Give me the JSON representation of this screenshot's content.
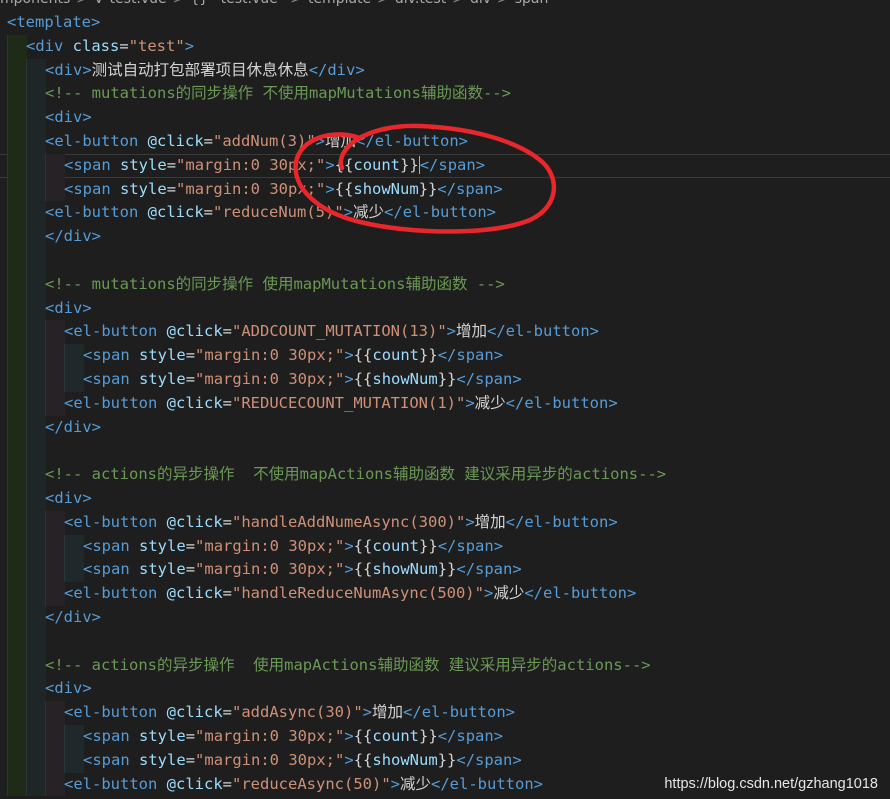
{
  "breadcrumb": [
    "mponents",
    ">",
    "V",
    "test.vue",
    ">",
    "{}",
    "\"test.vue\"",
    ">",
    "template",
    ">",
    "div.test",
    ">",
    "div",
    ">",
    "span"
  ],
  "colors": {
    "tag": "#569cd6",
    "attribute": "#9cdcfe",
    "string": "#ce9178",
    "comment": "#6a9955",
    "text": "#d4d4d4",
    "annotation_circle": "#e8262b"
  },
  "lines": [
    {
      "indent": 0,
      "cursor": false,
      "tokens": [
        [
          "tag",
          "<template"
        ],
        [
          "tag",
          ">"
        ]
      ]
    },
    {
      "indent": 1,
      "cursor": false,
      "tokens": [
        [
          "tag",
          "<div"
        ],
        [
          "text",
          " "
        ],
        [
          "attr",
          "class"
        ],
        [
          "text",
          "="
        ],
        [
          "str",
          "\"test\""
        ],
        [
          "tag",
          ">"
        ]
      ]
    },
    {
      "indent": 2,
      "cursor": false,
      "tokens": [
        [
          "tag",
          "<div>"
        ],
        [
          "text",
          "测试自动打包部署项目休息休息"
        ],
        [
          "tag",
          "</div>"
        ]
      ]
    },
    {
      "indent": 2,
      "cursor": false,
      "tokens": [
        [
          "cmt",
          "<!-- mutations的同步操作 不使用mapMutations辅助函数-->"
        ]
      ]
    },
    {
      "indent": 2,
      "cursor": false,
      "tokens": [
        [
          "tag",
          "<div>"
        ]
      ]
    },
    {
      "indent": 2,
      "cursor": false,
      "tokens": [
        [
          "tag",
          "<el-button"
        ],
        [
          "text",
          " "
        ],
        [
          "attr",
          "@click"
        ],
        [
          "text",
          "="
        ],
        [
          "str",
          "\"addNum(3)\""
        ],
        [
          "tag",
          ">"
        ],
        [
          "text",
          "增加"
        ],
        [
          "tag",
          "</el-button>"
        ]
      ]
    },
    {
      "indent": 3,
      "cursor": true,
      "tokens": [
        [
          "tag",
          "<span"
        ],
        [
          "text",
          " "
        ],
        [
          "attr",
          "style"
        ],
        [
          "text",
          "="
        ],
        [
          "str",
          "\"margin:0 30px;\""
        ],
        [
          "tag",
          ">"
        ],
        [
          "text",
          "{{"
        ],
        [
          "var",
          "count"
        ],
        [
          "text",
          "}}"
        ],
        [
          "tag",
          "</span>"
        ]
      ]
    },
    {
      "indent": 3,
      "cursor": false,
      "tokens": [
        [
          "tag",
          "<span"
        ],
        [
          "text",
          " "
        ],
        [
          "attr",
          "style"
        ],
        [
          "text",
          "="
        ],
        [
          "str",
          "\"margin:0 30px;\""
        ],
        [
          "tag",
          ">"
        ],
        [
          "text",
          "{{"
        ],
        [
          "var",
          "showNum"
        ],
        [
          "text",
          "}}"
        ],
        [
          "tag",
          "</span>"
        ]
      ]
    },
    {
      "indent": 2,
      "cursor": false,
      "tokens": [
        [
          "tag",
          "<el-button"
        ],
        [
          "text",
          " "
        ],
        [
          "attr",
          "@click"
        ],
        [
          "text",
          "="
        ],
        [
          "str",
          "\"reduceNum(5)\""
        ],
        [
          "tag",
          ">"
        ],
        [
          "text",
          "减少"
        ],
        [
          "tag",
          "</el-button>"
        ]
      ]
    },
    {
      "indent": 2,
      "cursor": false,
      "tokens": [
        [
          "tag",
          "</div>"
        ]
      ]
    },
    {
      "indent": 2,
      "cursor": false,
      "tokens": []
    },
    {
      "indent": 2,
      "cursor": false,
      "tokens": [
        [
          "cmt",
          "<!-- mutations的同步操作 使用mapMutations辅助函数 -->"
        ]
      ]
    },
    {
      "indent": 2,
      "cursor": false,
      "tokens": [
        [
          "tag",
          "<div>"
        ]
      ]
    },
    {
      "indent": 3,
      "cursor": false,
      "tokens": [
        [
          "tag",
          "<el-button"
        ],
        [
          "text",
          " "
        ],
        [
          "attr",
          "@click"
        ],
        [
          "text",
          "="
        ],
        [
          "str",
          "\"ADDCOUNT_MUTATION(13)\""
        ],
        [
          "tag",
          ">"
        ],
        [
          "text",
          "增加"
        ],
        [
          "tag",
          "</el-button>"
        ]
      ]
    },
    {
      "indent": 4,
      "cursor": false,
      "tokens": [
        [
          "tag",
          "<span"
        ],
        [
          "text",
          " "
        ],
        [
          "attr",
          "style"
        ],
        [
          "text",
          "="
        ],
        [
          "str",
          "\"margin:0 30px;\""
        ],
        [
          "tag",
          ">"
        ],
        [
          "text",
          "{{"
        ],
        [
          "var",
          "count"
        ],
        [
          "text",
          "}}"
        ],
        [
          "tag",
          "</span>"
        ]
      ]
    },
    {
      "indent": 4,
      "cursor": false,
      "tokens": [
        [
          "tag",
          "<span"
        ],
        [
          "text",
          " "
        ],
        [
          "attr",
          "style"
        ],
        [
          "text",
          "="
        ],
        [
          "str",
          "\"margin:0 30px;\""
        ],
        [
          "tag",
          ">"
        ],
        [
          "text",
          "{{"
        ],
        [
          "var",
          "showNum"
        ],
        [
          "text",
          "}}"
        ],
        [
          "tag",
          "</span>"
        ]
      ]
    },
    {
      "indent": 3,
      "cursor": false,
      "tokens": [
        [
          "tag",
          "<el-button"
        ],
        [
          "text",
          " "
        ],
        [
          "attr",
          "@click"
        ],
        [
          "text",
          "="
        ],
        [
          "str",
          "\"REDUCECOUNT_MUTATION(1)\""
        ],
        [
          "tag",
          ">"
        ],
        [
          "text",
          "减少"
        ],
        [
          "tag",
          "</el-button>"
        ]
      ]
    },
    {
      "indent": 2,
      "cursor": false,
      "tokens": [
        [
          "tag",
          "</div>"
        ]
      ]
    },
    {
      "indent": 2,
      "cursor": false,
      "tokens": []
    },
    {
      "indent": 2,
      "cursor": false,
      "tokens": [
        [
          "cmt",
          "<!-- actions的异步操作  不使用mapActions辅助函数 建议采用异步的actions-->"
        ]
      ]
    },
    {
      "indent": 2,
      "cursor": false,
      "tokens": [
        [
          "tag",
          "<div>"
        ]
      ]
    },
    {
      "indent": 3,
      "cursor": false,
      "tokens": [
        [
          "tag",
          "<el-button"
        ],
        [
          "text",
          " "
        ],
        [
          "attr",
          "@click"
        ],
        [
          "text",
          "="
        ],
        [
          "str",
          "\"handleAddNumeAsync(300)\""
        ],
        [
          "tag",
          ">"
        ],
        [
          "text",
          "增加"
        ],
        [
          "tag",
          "</el-button>"
        ]
      ]
    },
    {
      "indent": 4,
      "cursor": false,
      "tokens": [
        [
          "tag",
          "<span"
        ],
        [
          "text",
          " "
        ],
        [
          "attr",
          "style"
        ],
        [
          "text",
          "="
        ],
        [
          "str",
          "\"margin:0 30px;\""
        ],
        [
          "tag",
          ">"
        ],
        [
          "text",
          "{{"
        ],
        [
          "var",
          "count"
        ],
        [
          "text",
          "}}"
        ],
        [
          "tag",
          "</span>"
        ]
      ]
    },
    {
      "indent": 4,
      "cursor": false,
      "tokens": [
        [
          "tag",
          "<span"
        ],
        [
          "text",
          " "
        ],
        [
          "attr",
          "style"
        ],
        [
          "text",
          "="
        ],
        [
          "str",
          "\"margin:0 30px;\""
        ],
        [
          "tag",
          ">"
        ],
        [
          "text",
          "{{"
        ],
        [
          "var",
          "showNum"
        ],
        [
          "text",
          "}}"
        ],
        [
          "tag",
          "</span>"
        ]
      ]
    },
    {
      "indent": 3,
      "cursor": false,
      "tokens": [
        [
          "tag",
          "<el-button"
        ],
        [
          "text",
          " "
        ],
        [
          "attr",
          "@click"
        ],
        [
          "text",
          "="
        ],
        [
          "str",
          "\"handleReduceNumAsync(500)\""
        ],
        [
          "tag",
          ">"
        ],
        [
          "text",
          "减少"
        ],
        [
          "tag",
          "</el-button>"
        ]
      ]
    },
    {
      "indent": 2,
      "cursor": false,
      "tokens": [
        [
          "tag",
          "</div>"
        ]
      ]
    },
    {
      "indent": 2,
      "cursor": false,
      "tokens": []
    },
    {
      "indent": 2,
      "cursor": false,
      "tokens": [
        [
          "cmt",
          "<!-- actions的异步操作  使用mapActions辅助函数 建议采用异步的actions-->"
        ]
      ]
    },
    {
      "indent": 2,
      "cursor": false,
      "tokens": [
        [
          "tag",
          "<div>"
        ]
      ]
    },
    {
      "indent": 3,
      "cursor": false,
      "tokens": [
        [
          "tag",
          "<el-button"
        ],
        [
          "text",
          " "
        ],
        [
          "attr",
          "@click"
        ],
        [
          "text",
          "="
        ],
        [
          "str",
          "\"addAsync(30)\""
        ],
        [
          "tag",
          ">"
        ],
        [
          "text",
          "增加"
        ],
        [
          "tag",
          "</el-button>"
        ]
      ]
    },
    {
      "indent": 4,
      "cursor": false,
      "tokens": [
        [
          "tag",
          "<span"
        ],
        [
          "text",
          " "
        ],
        [
          "attr",
          "style"
        ],
        [
          "text",
          "="
        ],
        [
          "str",
          "\"margin:0 30px;\""
        ],
        [
          "tag",
          ">"
        ],
        [
          "text",
          "{{"
        ],
        [
          "var",
          "count"
        ],
        [
          "text",
          "}}"
        ],
        [
          "tag",
          "</span>"
        ]
      ]
    },
    {
      "indent": 4,
      "cursor": false,
      "tokens": [
        [
          "tag",
          "<span"
        ],
        [
          "text",
          " "
        ],
        [
          "attr",
          "style"
        ],
        [
          "text",
          "="
        ],
        [
          "str",
          "\"margin:0 30px;\""
        ],
        [
          "tag",
          ">"
        ],
        [
          "text",
          "{{"
        ],
        [
          "var",
          "showNum"
        ],
        [
          "text",
          "}}"
        ],
        [
          "tag",
          "</span>"
        ]
      ]
    },
    {
      "indent": 3,
      "cursor": false,
      "tokens": [
        [
          "tag",
          "<el-button"
        ],
        [
          "text",
          " "
        ],
        [
          "attr",
          "@click"
        ],
        [
          "text",
          "="
        ],
        [
          "str",
          "\"reduceAsync(50)\""
        ],
        [
          "tag",
          ">"
        ],
        [
          "text",
          "减少"
        ],
        [
          "tag",
          "</el-button>"
        ]
      ]
    }
  ],
  "watermark": "https://blog.csdn.net/gzhang1018"
}
